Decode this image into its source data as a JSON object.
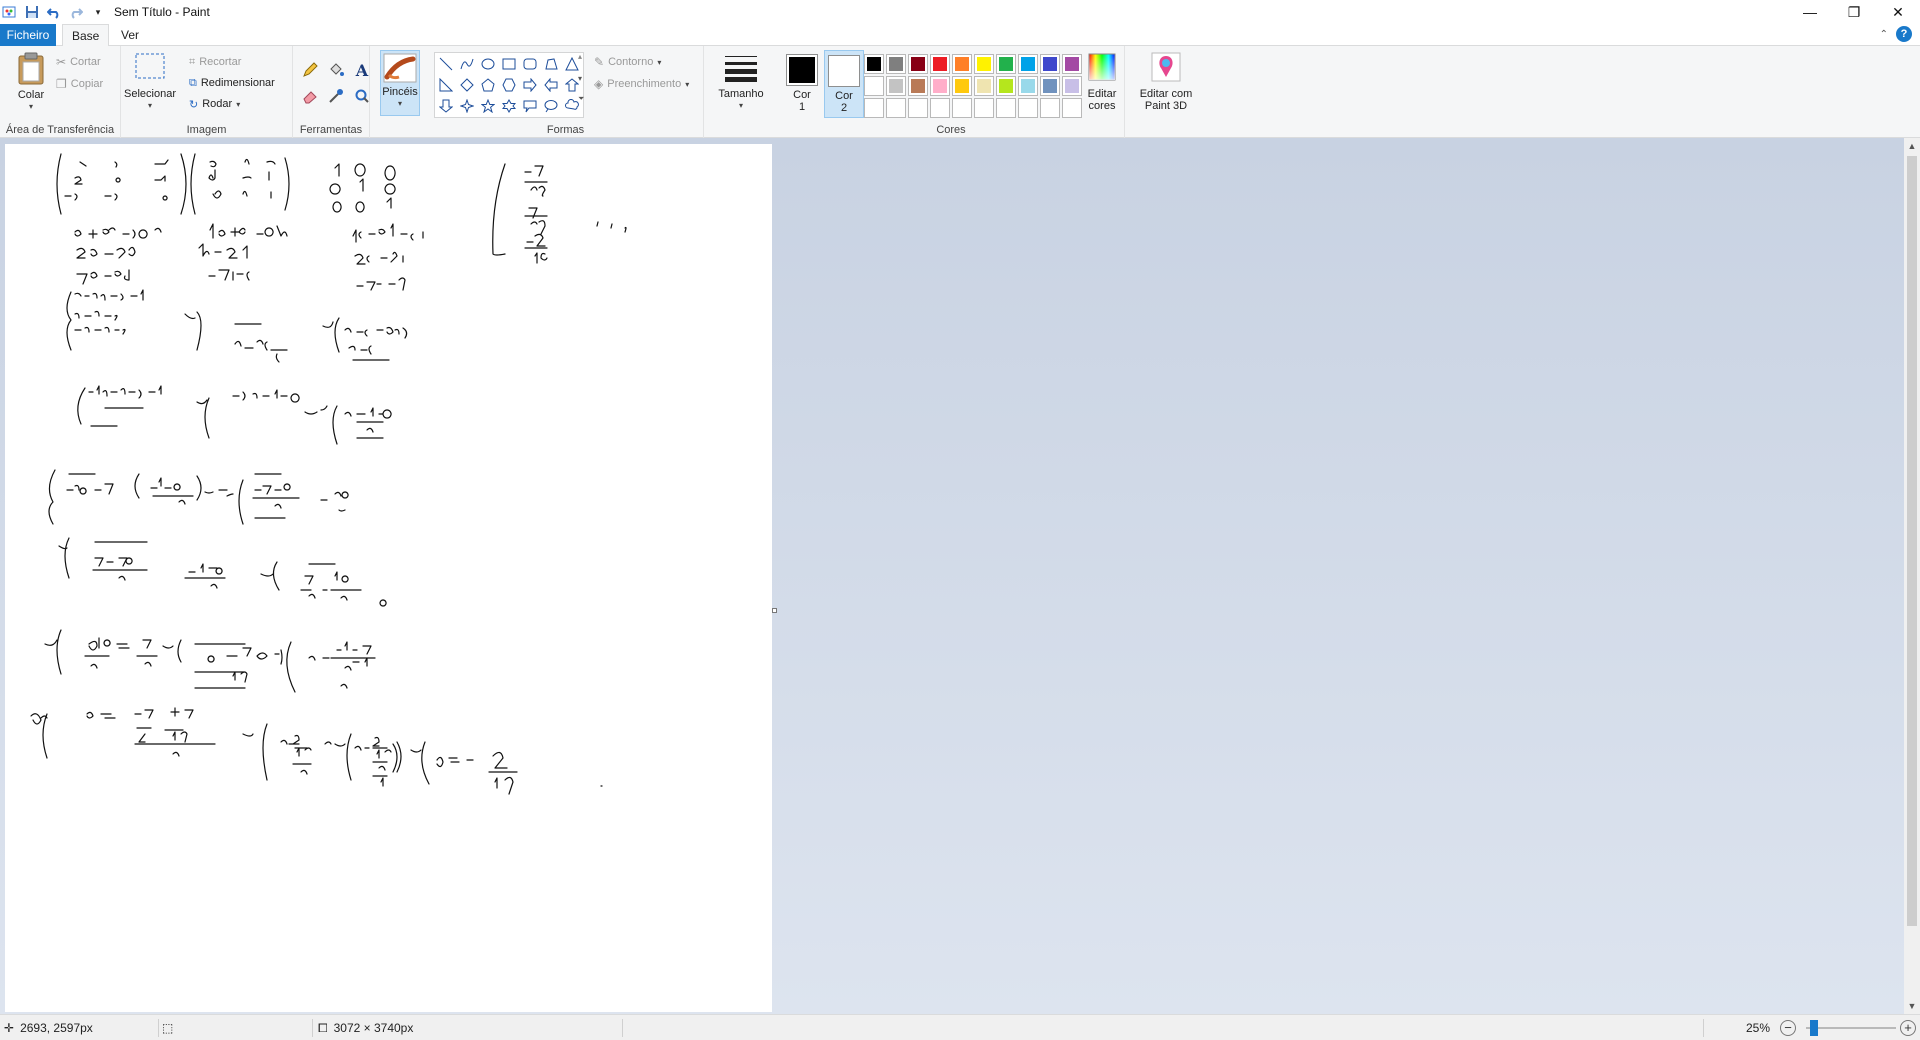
{
  "window": {
    "title": "Sem Título - Paint",
    "minimize": "—",
    "maximize": "❐",
    "close": "✕"
  },
  "tabs": {
    "file": "Ficheiro",
    "home": "Base",
    "view": "Ver"
  },
  "ribbon": {
    "clipboard": {
      "paste": "Colar",
      "cut": "Cortar",
      "copy": "Copiar",
      "group_label": "Área de Transferência"
    },
    "image": {
      "select": "Selecionar",
      "crop": "Recortar",
      "resize": "Redimensionar",
      "rotate": "Rodar",
      "group_label": "Imagem"
    },
    "tools": {
      "group_label": "Ferramentas"
    },
    "brushes": {
      "label": "Pincéis"
    },
    "shapes": {
      "outline": "Contorno",
      "fill": "Preenchimento",
      "group_label": "Formas"
    },
    "size": {
      "label": "Tamanho"
    },
    "colors": {
      "color1_line1": "Cor",
      "color1_line2": "1",
      "color2_line1": "Cor",
      "color2_line2": "2",
      "color1": "#000000",
      "color2": "#ffffff",
      "edit_line1": "Editar",
      "edit_line2": "cores",
      "group_label": "Cores",
      "palette_row1": [
        "#000000",
        "#7f7f7f",
        "#880015",
        "#ed1c24",
        "#ff7f27",
        "#fff200",
        "#22b14c",
        "#00a2e8",
        "#3f48cc",
        "#a349a4"
      ],
      "palette_row2": [
        "#ffffff",
        "#c3c3c3",
        "#b97a57",
        "#ffaec9",
        "#ffc90e",
        "#efe4b0",
        "#b5e61d",
        "#99d9ea",
        "#7092be",
        "#c8bfe7"
      ]
    },
    "paint3d": {
      "line1": "Editar com",
      "line2": "Paint 3D"
    }
  },
  "status": {
    "cursor_position": "2693, 2597px",
    "image_size": "3072 × 3740px",
    "zoom": "25%"
  }
}
